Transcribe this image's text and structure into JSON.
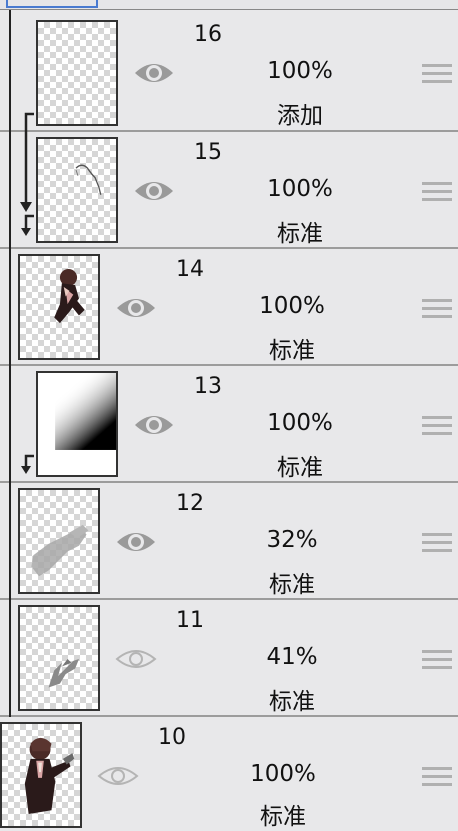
{
  "layers": [
    {
      "number": "16",
      "opacity": "100%",
      "blend": "添加",
      "visible": true,
      "clipped": true,
      "thumb": "blank"
    },
    {
      "number": "15",
      "opacity": "100%",
      "blend": "标准",
      "visible": true,
      "clipped": true,
      "thumb": "stroke"
    },
    {
      "number": "14",
      "opacity": "100%",
      "blend": "标准",
      "visible": true,
      "clipped": false,
      "thumb": "character"
    },
    {
      "number": "13",
      "opacity": "100%",
      "blend": "标准",
      "visible": true,
      "clipped": true,
      "thumb": "gradient"
    },
    {
      "number": "12",
      "opacity": "32%",
      "blend": "标准",
      "visible": true,
      "clipped": false,
      "thumb": "shadow"
    },
    {
      "number": "11",
      "opacity": "41%",
      "blend": "标准",
      "visible": false,
      "clipped": false,
      "thumb": "scribble"
    },
    {
      "number": "10",
      "opacity": "100%",
      "blend": "标准",
      "visible": false,
      "clipped": false,
      "thumb": "character-full"
    }
  ],
  "colors": {
    "eye_visible": "#9a9a9a",
    "eye_hidden": "#b4b4b4",
    "handle": "#b0b0b0"
  },
  "icons": {
    "visibility": "eye-icon",
    "reorder": "drag-handle-icon",
    "clip": "clip-arrow-icon"
  }
}
